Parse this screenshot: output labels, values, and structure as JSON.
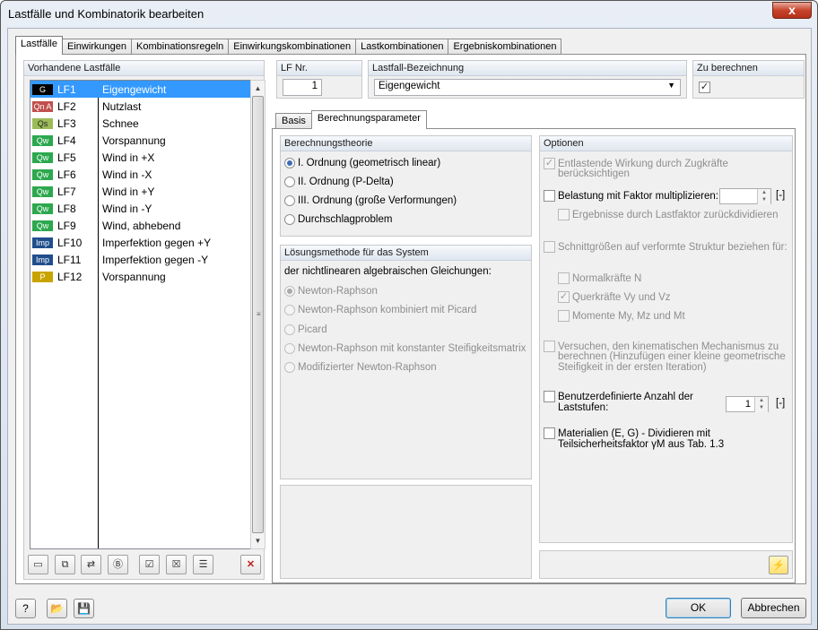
{
  "window": {
    "title": "Lastfälle und Kombinatorik bearbeiten",
    "close_glyph": "x"
  },
  "main_tabs": [
    {
      "label": "Lastfälle",
      "active": true
    },
    {
      "label": "Einwirkungen"
    },
    {
      "label": "Kombinationsregeln"
    },
    {
      "label": "Einwirkungskombinationen"
    },
    {
      "label": "Lastkombinationen"
    },
    {
      "label": "Ergebniskombinationen"
    }
  ],
  "load_cases": {
    "header": "Vorhandene Lastfälle",
    "items": [
      {
        "badge": "G",
        "badge_color": "#000000",
        "id": "LF1",
        "name": "Eigengewicht",
        "selected": true
      },
      {
        "badge": "Qn A",
        "badge_color": "#c0504d",
        "id": "LF2",
        "name": "Nutzlast"
      },
      {
        "badge": "Qs",
        "badge_color": "#9bbb59",
        "id": "LF3",
        "name": "Schnee"
      },
      {
        "badge": "Qw",
        "badge_color": "#2ca84e",
        "id": "LF4",
        "name": "Vorspannung"
      },
      {
        "badge": "Qw",
        "badge_color": "#2ca84e",
        "id": "LF5",
        "name": "Wind in +X"
      },
      {
        "badge": "Qw",
        "badge_color": "#2ca84e",
        "id": "LF6",
        "name": "Wind in -X"
      },
      {
        "badge": "Qw",
        "badge_color": "#2ca84e",
        "id": "LF7",
        "name": "Wind in +Y"
      },
      {
        "badge": "Qw",
        "badge_color": "#2ca84e",
        "id": "LF8",
        "name": "Wind in -Y"
      },
      {
        "badge": "Qw",
        "badge_color": "#2ca84e",
        "id": "LF9",
        "name": "Wind, abhebend"
      },
      {
        "badge": "Imp",
        "badge_color": "#1f4e8c",
        "id": "LF10",
        "name": "Imperfektion gegen +Y"
      },
      {
        "badge": "Imp",
        "badge_color": "#1f4e8c",
        "id": "LF11",
        "name": "Imperfektion gegen -Y"
      },
      {
        "badge": "P",
        "badge_color": "#c9a400",
        "id": "LF12",
        "name": "Vorspannung"
      }
    ],
    "tools": [
      "new-load-case-icon",
      "copy-load-case-icon",
      "renumber-icon",
      "load-case-properties-icon",
      "check-all-icon",
      "uncheck-all-icon",
      "select-icon",
      "delete-icon"
    ]
  },
  "lf_nr": {
    "label": "LF Nr.",
    "value": "1"
  },
  "bezeichnung": {
    "label": "Lastfall-Bezeichnung",
    "value": "Eigengewicht"
  },
  "zu_berechnen": {
    "label": "Zu berechnen",
    "checked": true
  },
  "sub_tabs": [
    {
      "label": "Basis"
    },
    {
      "label": "Berechnungsparameter",
      "active": true
    }
  ],
  "theory": {
    "header": "Berechnungstheorie",
    "options": [
      {
        "label": "I. Ordnung (geometrisch linear)",
        "selected": true
      },
      {
        "label": "II. Ordnung (P-Delta)"
      },
      {
        "label": "III. Ordnung (große Verformungen)"
      },
      {
        "label": "Durchschlagproblem"
      }
    ]
  },
  "method": {
    "header": "Lösungsmethode für das System",
    "intro": "der nichtlinearen algebraischen Gleichungen:",
    "options": [
      {
        "label": "Newton-Raphson",
        "selected": true
      },
      {
        "label": "Newton-Raphson kombiniert mit Picard"
      },
      {
        "label": "Picard"
      },
      {
        "label": "Newton-Raphson mit konstanter Steifigkeitsmatrix"
      },
      {
        "label": "Modifizierter Newton-Raphson"
      }
    ]
  },
  "options": {
    "header": "Optionen",
    "entlastende": {
      "line1": "Entlastende Wirkung durch Zugkräfte",
      "line2": "berücksichtigen",
      "checked": true
    },
    "belastung": {
      "label": "Belastung mit Faktor multiplizieren:",
      "unit": "[-]"
    },
    "ergebnisse": {
      "label": "Ergebnisse durch Lastfaktor zurückdividieren"
    },
    "schnitt": {
      "label": "Schnittgrößen auf verformte Struktur beziehen für:"
    },
    "normal": {
      "label": "Normalkräfte N"
    },
    "quer": {
      "label": "Querkräfte Vy und Vz",
      "checked": true
    },
    "momente": {
      "label": "Momente My, Mz und Mt"
    },
    "versuchen": {
      "line1": "Versuchen, den kinematischen Mechanismus zu",
      "line2": "berechnen (Hinzufügen einer kleine geometrische",
      "line3": "Steifigkeit in der ersten Iteration)"
    },
    "benutzer": {
      "line1": "Benutzerdefinierte Anzahl der",
      "line2": "Laststufen:",
      "value": "1",
      "unit": "[-]"
    },
    "materialien": {
      "line1": "Materialien (E, G) - Dividieren mit",
      "line2": "Teilsicherheitsfaktor γM aus Tab. 1.3"
    }
  },
  "buttons": {
    "ok": "OK",
    "cancel": "Abbrechen"
  },
  "bottom_icons": [
    "help-icon",
    "open-icon",
    "save-icon"
  ]
}
